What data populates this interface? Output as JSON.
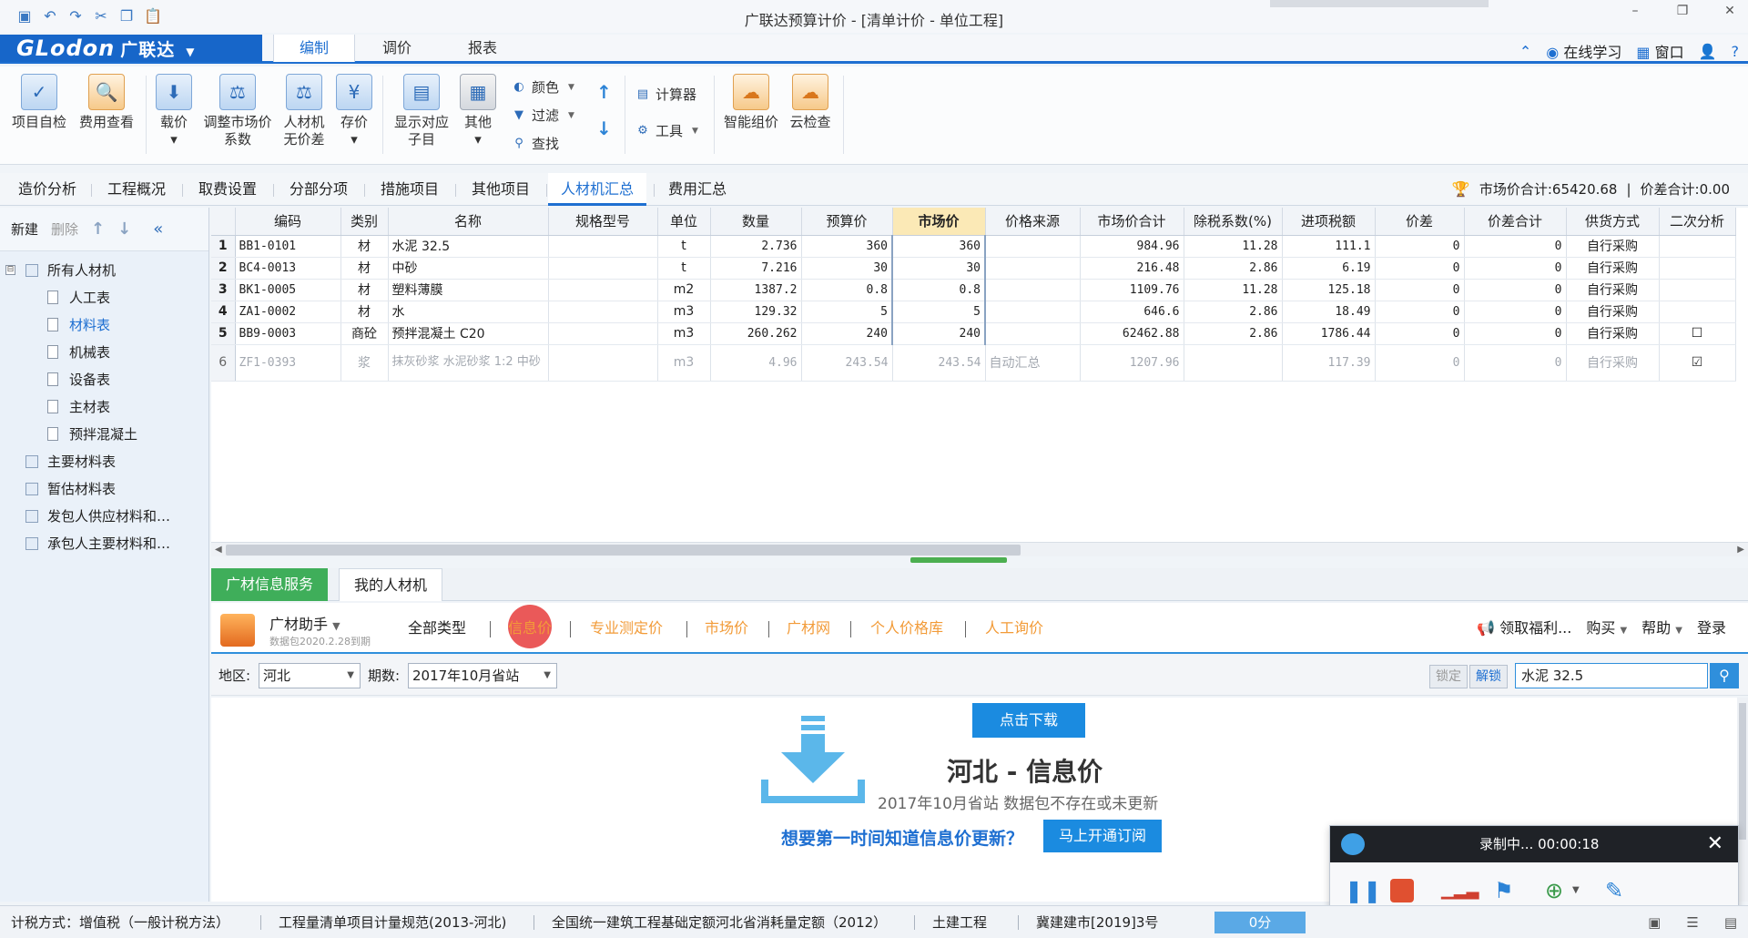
{
  "window": {
    "title": "广联达预算计价 - [清单计价 - 单位工程]",
    "controls": [
      "–",
      "❐",
      "✕"
    ]
  },
  "quick_access": [
    "save-icon",
    "undo-icon",
    "redo-icon",
    "cut-icon",
    "copy-icon",
    "paste-icon"
  ],
  "brand": {
    "logo_text": "GLodon",
    "logo_cn": "广联达",
    "caret": "▼"
  },
  "menu": {
    "tabs": [
      "编制",
      "调价",
      "报表"
    ],
    "right": {
      "learn": "在线学习",
      "window": "窗口",
      "help": "?"
    }
  },
  "ribbon": {
    "buttons": [
      {
        "label1": "项目自检",
        "label2": ""
      },
      {
        "label1": "费用查看",
        "label2": ""
      },
      {
        "label1": "载价",
        "label2": "▾"
      },
      {
        "label1": "调整市场价",
        "label2": "系数"
      },
      {
        "label1": "人材机",
        "label2": "无价差"
      },
      {
        "label1": "存价",
        "label2": "▾"
      },
      {
        "label1": "显示对应",
        "label2": "子目"
      },
      {
        "label1": "其他",
        "label2": "▾"
      }
    ],
    "small": {
      "color": "颜色",
      "filter": "过滤",
      "find": "查找",
      "calculator": "计算器",
      "tools": "工具"
    },
    "ai": [
      {
        "label": "智能组价"
      },
      {
        "label": "云检查"
      }
    ]
  },
  "page_tabs": [
    "造价分析",
    "工程概况",
    "取费设置",
    "分部分项",
    "措施项目",
    "其他项目",
    "人材机汇总",
    "费用汇总"
  ],
  "totals": {
    "market_total": "市场价合计:65420.68",
    "diff_total": "价差合计:0.00"
  },
  "left": {
    "toolbar": {
      "new": "新建",
      "delete": "删除"
    },
    "tree": [
      {
        "label": "所有人材机",
        "level": 0,
        "exp": "⊟"
      },
      {
        "label": "人工表",
        "level": 1
      },
      {
        "label": "材料表",
        "level": 1,
        "selected": true
      },
      {
        "label": "机械表",
        "level": 1
      },
      {
        "label": "设备表",
        "level": 1
      },
      {
        "label": "主材表",
        "level": 1
      },
      {
        "label": "预拌混凝土",
        "level": 1
      },
      {
        "label": "主要材料表",
        "level": 0
      },
      {
        "label": "暂估材料表",
        "level": 0
      },
      {
        "label": "发包人供应材料和…",
        "level": 0
      },
      {
        "label": "承包人主要材料和…",
        "level": 0
      }
    ]
  },
  "grid": {
    "headers": [
      "编码",
      "类别",
      "名称",
      "规格型号",
      "单位",
      "数量",
      "预算价",
      "市场价",
      "价格来源",
      "市场价合计",
      "除税系数(%)",
      "进项税额",
      "价差",
      "价差合计",
      "供货方式",
      "二次分析"
    ],
    "rows": [
      {
        "no": "1",
        "code": "BB1-0101",
        "type": "材",
        "name": "水泥 32.5",
        "spec": "",
        "unit": "t",
        "qty": "2.736",
        "budget": "360",
        "market": "360",
        "source": "",
        "total": "984.96",
        "tax_rate": "11.28",
        "tax": "111.1",
        "diff": "0",
        "diff_total": "0",
        "supply": "自行采购",
        "analysis": ""
      },
      {
        "no": "2",
        "code": "BC4-0013",
        "type": "材",
        "name": "中砂",
        "spec": "",
        "unit": "t",
        "qty": "7.216",
        "budget": "30",
        "market": "30",
        "source": "",
        "total": "216.48",
        "tax_rate": "2.86",
        "tax": "6.19",
        "diff": "0",
        "diff_total": "0",
        "supply": "自行采购",
        "analysis": ""
      },
      {
        "no": "3",
        "code": "BK1-0005",
        "type": "材",
        "name": "塑料薄膜",
        "spec": "",
        "unit": "m2",
        "qty": "1387.2",
        "budget": "0.8",
        "market": "0.8",
        "source": "",
        "total": "1109.76",
        "tax_rate": "11.28",
        "tax": "125.18",
        "diff": "0",
        "diff_total": "0",
        "supply": "自行采购",
        "analysis": ""
      },
      {
        "no": "4",
        "code": "ZA1-0002",
        "type": "材",
        "name": "水",
        "spec": "",
        "unit": "m3",
        "qty": "129.32",
        "budget": "5",
        "market": "5",
        "source": "",
        "total": "646.6",
        "tax_rate": "2.86",
        "tax": "18.49",
        "diff": "0",
        "diff_total": "0",
        "supply": "自行采购",
        "analysis": ""
      },
      {
        "no": "5",
        "code": "BB9-0003",
        "type": "商砼",
        "name": "预拌混凝土 C20",
        "spec": "",
        "unit": "m3",
        "qty": "260.262",
        "budget": "240",
        "market": "240",
        "source": "",
        "total": "62462.88",
        "tax_rate": "2.86",
        "tax": "1786.44",
        "diff": "0",
        "diff_total": "0",
        "supply": "自行采购",
        "analysis": "☐"
      },
      {
        "no": "6",
        "code": "ZF1-0393",
        "type": "浆",
        "name": "抹灰砂浆 水泥砂浆 1:2 中砂",
        "spec": "",
        "unit": "m3",
        "qty": "4.96",
        "budget": "243.54",
        "market": "243.54",
        "source": "自动汇总",
        "total": "1207.96",
        "tax_rate": "",
        "tax": "117.39",
        "diff": "0",
        "diff_total": "0",
        "supply": "自行采购",
        "analysis": "☑"
      }
    ]
  },
  "bottom": {
    "tabs": [
      "广材信息服务",
      "我的人材机"
    ],
    "helper": {
      "name": "广材助手",
      "sub": "数据包2020.2.28到期"
    },
    "links": [
      "全部类型",
      "信息价",
      "专业测定价",
      "市场价",
      "广材网",
      "个人价格库",
      "人工询价"
    ],
    "right": {
      "welfare": "领取福利...",
      "buy": "购买",
      "help": "帮助",
      "login": "登录"
    },
    "filter": {
      "region_label": "地区:",
      "region": "河北",
      "period_label": "期数:",
      "period": "2017年10月省站",
      "lock": "锁定",
      "unlock": "解锁",
      "search": "水泥 32.5"
    },
    "info": {
      "download": "点击下载",
      "title": "河北 - 信息价",
      "subtitle": "2017年10月省站 数据包不存在或未更新",
      "promo": "想要第一时间知道信息价更新？",
      "subscribe": "马上开通订阅"
    }
  },
  "recorder": {
    "status": "录制中... 00:00:18"
  },
  "status": {
    "tax_mode": "计税方式：增值税（一般计税方法）",
    "spec": "工程量清单项目计量规范(2013-河北)",
    "quota": "全国统一建筑工程基础定额河北省消耗量定额（2012）",
    "discipline": "土建工程",
    "doc": "冀建建市[2019]3号",
    "score": "0分"
  },
  "colors": {
    "brand": "#1766c9",
    "accent": "#1e6fd1",
    "green_tab": "#3fae5a",
    "orange_link": "#f29b38"
  }
}
